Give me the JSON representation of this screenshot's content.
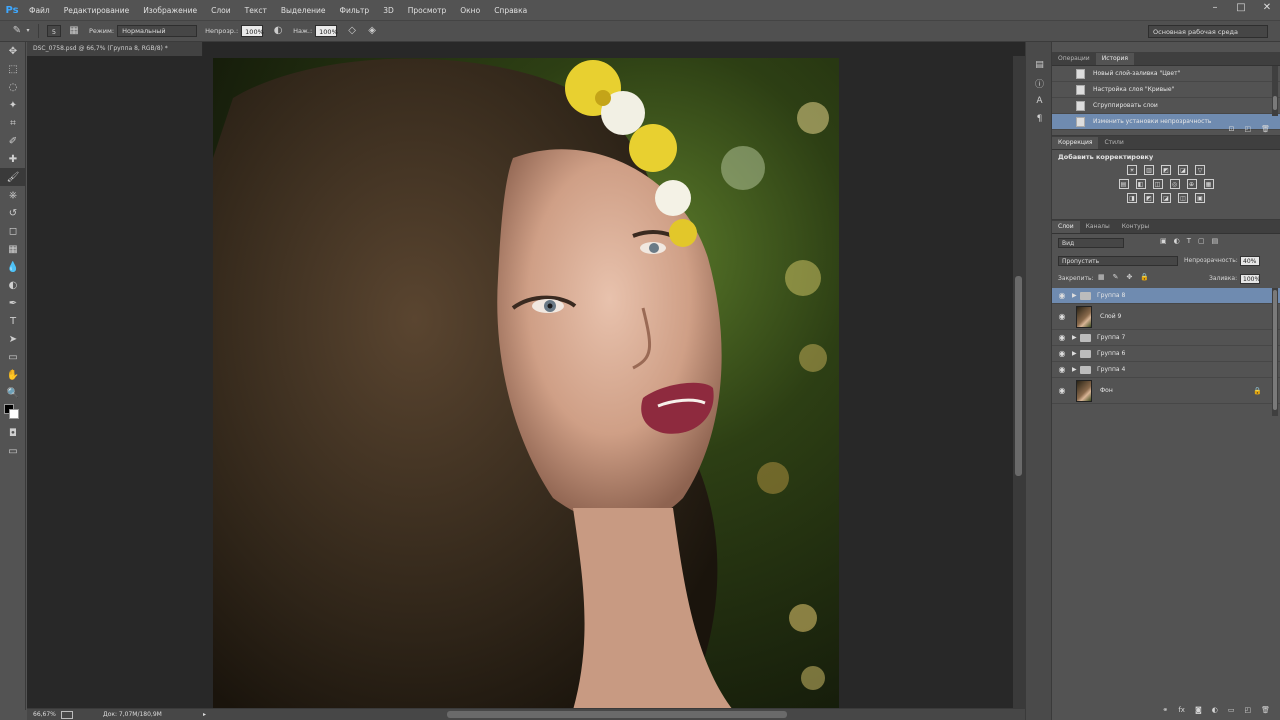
{
  "app": {
    "logo": "Ps"
  },
  "menu": [
    "Файл",
    "Редактирование",
    "Изображение",
    "Слои",
    "Текст",
    "Выделение",
    "Фильтр",
    "3D",
    "Просмотр",
    "Окно",
    "Справка"
  ],
  "window_controls": [
    "–",
    "□",
    "✕"
  ],
  "options": {
    "size": "5",
    "mode_label": "Режим:",
    "mode_value": "Нормальный",
    "opacity_label": "Непрозр.:",
    "opacity_value": "100%",
    "flow_label": "Наж.:",
    "flow_value": "100%",
    "workspace": "Основная рабочая среда"
  },
  "document": {
    "tab_title": "DSC_0758.psd @ 66,7% (Группа 8, RGB/8) *",
    "zoom": "66,67%",
    "doc_info": "Док: 7,07M/180,9M"
  },
  "history_panel": {
    "tabs": [
      "Операции",
      "История"
    ],
    "active_tab": 1,
    "items": [
      {
        "label": "Новый слой-заливка \"Цвет\""
      },
      {
        "label": "Настройка слоя \"Кривые\""
      },
      {
        "label": "Сгруппировать слои"
      },
      {
        "label": "Изменить установки непрозрачность"
      }
    ],
    "selected_index": 3
  },
  "adjustments_panel": {
    "tabs": [
      "Коррекция",
      "Стили"
    ],
    "active_tab": 0,
    "title": "Добавить корректировку",
    "icon_rows": [
      [
        "☀",
        "▥",
        "◩",
        "◪",
        "▽"
      ],
      [
        "▤",
        "◧",
        "◫",
        "◎",
        "⊕",
        "▦"
      ],
      [
        "◨",
        "◩",
        "◪",
        "◫",
        "▣"
      ]
    ]
  },
  "layers_panel": {
    "tabs": [
      "Слои",
      "Каналы",
      "Контуры"
    ],
    "active_tab": 0,
    "kind_value": "Вид",
    "blend_value": "Пропустить",
    "opacity_label": "Непрозрачность:",
    "opacity_value": "40%",
    "lock_label": "Закрепить:",
    "fill_label": "Заливка:",
    "fill_value": "100%",
    "layers": [
      {
        "name": "Группа 8",
        "type": "group",
        "selected": true
      },
      {
        "name": "Слой 9",
        "type": "pixel",
        "selected": false
      },
      {
        "name": "Группа 7",
        "type": "group",
        "selected": false
      },
      {
        "name": "Группа 6",
        "type": "group",
        "selected": false
      },
      {
        "name": "Группа 4",
        "type": "group",
        "selected": false
      },
      {
        "name": "Фон",
        "type": "background",
        "selected": false,
        "locked": true
      }
    ]
  },
  "icons": {
    "tools": [
      "move-tool-icon",
      "marquee-tool-icon",
      "lasso-tool-icon",
      "quick-select-icon",
      "crop-tool-icon",
      "eyedropper-icon",
      "healing-brush-icon",
      "brush-tool-icon",
      "clone-stamp-icon",
      "history-brush-icon",
      "eraser-icon",
      "gradient-icon",
      "blur-icon",
      "dodge-icon",
      "pen-tool-icon",
      "type-tool-icon",
      "path-select-icon",
      "shape-tool-icon",
      "hand-tool-icon",
      "zoom-tool-icon"
    ]
  }
}
